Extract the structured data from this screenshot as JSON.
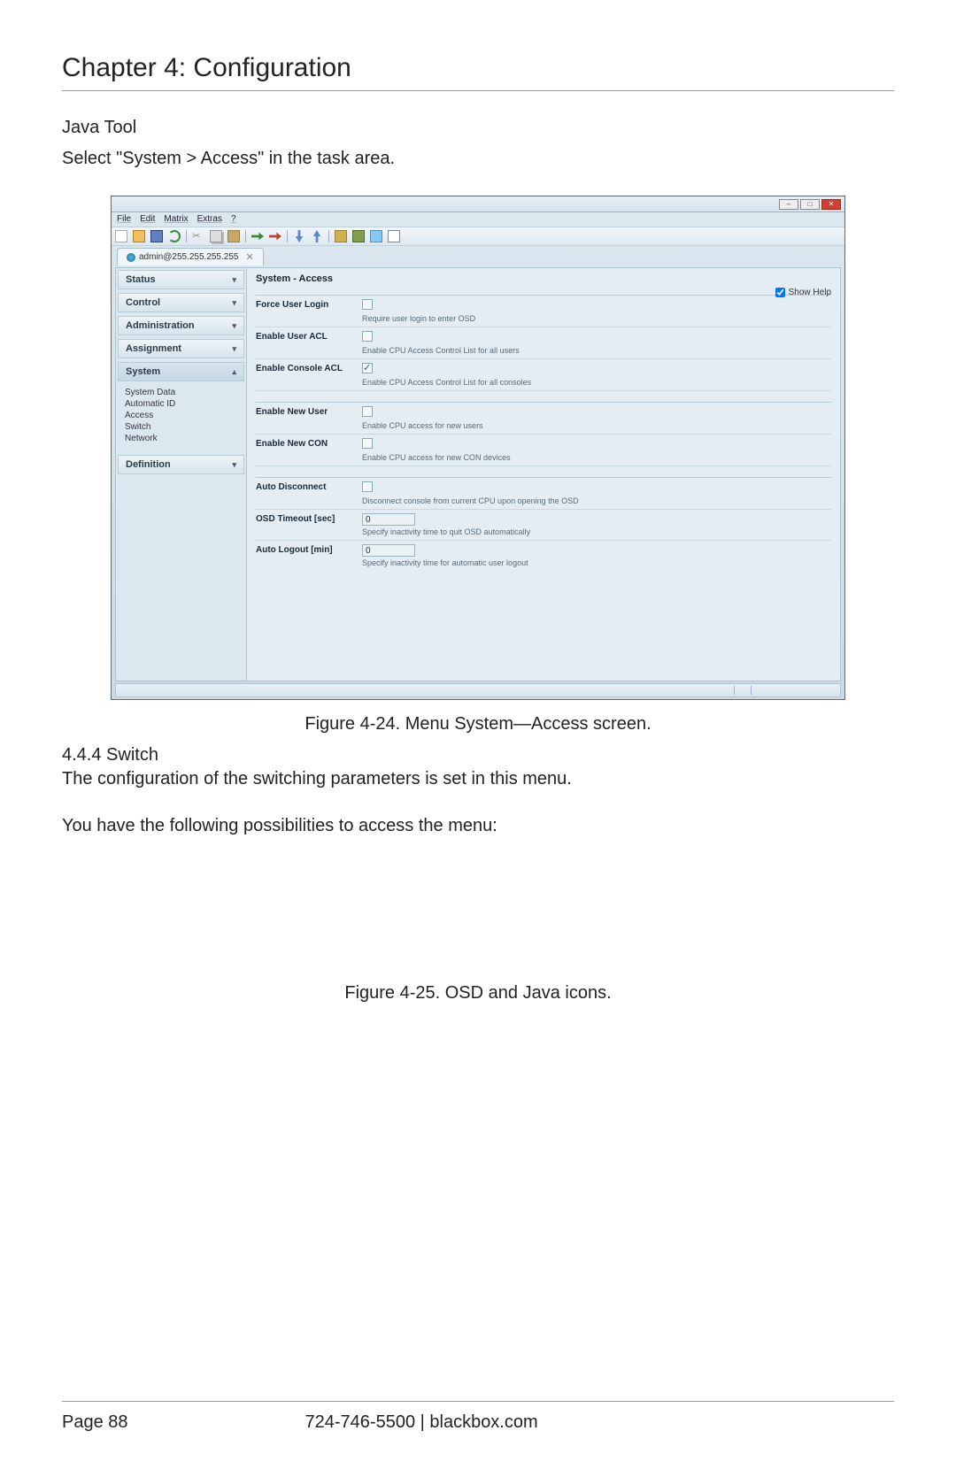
{
  "chapter_title": "Chapter 4: Configuration",
  "section_title": "Java Tool",
  "intro_text": "Select \"System > Access\" in the task area.",
  "figure24_caption": "Figure 4-24. Menu System—Access screen.",
  "subsection": "4.4.4 Switch",
  "switch_text1": "The configuration of the switching parameters is set in this menu.",
  "switch_text2": "You have the following possibilities to access the menu:",
  "figure25_caption": "Figure 4-25. OSD and Java icons.",
  "footer_page": "Page 88",
  "footer_contact": "724-746-5500   |   blackbox.com",
  "app": {
    "menubar": {
      "file": "File",
      "edit": "Edit",
      "matrix": "Matrix",
      "extras": "Extras",
      "help": "?"
    },
    "tab_label": "admin@255.255.255.255",
    "sidebar": {
      "items": [
        {
          "label": "Status",
          "arrow": "▾"
        },
        {
          "label": "Control",
          "arrow": "▾"
        },
        {
          "label": "Administration",
          "arrow": "▾"
        },
        {
          "label": "Assignment",
          "arrow": "▾"
        },
        {
          "label": "System",
          "arrow": "▴",
          "active": true
        },
        {
          "label": "Definition",
          "arrow": "▾"
        }
      ],
      "system_sub": [
        "System Data",
        "Automatic ID",
        "Access",
        "Switch",
        "Network"
      ]
    },
    "panel": {
      "title": "System - Access",
      "show_help": "Show Help",
      "show_help_checked": true,
      "rows": [
        {
          "label": "Force User Login",
          "type": "checkbox",
          "checked": false,
          "help": "Require user login to enter OSD"
        },
        {
          "label": "Enable User ACL",
          "type": "checkbox",
          "checked": false,
          "help": "Enable CPU Access Control List for all users"
        },
        {
          "label": "Enable Console ACL",
          "type": "checkbox",
          "checked": true,
          "help": "Enable CPU Access Control List for all consoles"
        }
      ],
      "rows2": [
        {
          "label": "Enable New User",
          "type": "checkbox",
          "checked": false,
          "help": "Enable CPU access for new users"
        },
        {
          "label": "Enable New CON",
          "type": "checkbox",
          "checked": false,
          "help": "Enable CPU access for new CON devices"
        }
      ],
      "rows3": [
        {
          "label": "Auto Disconnect",
          "type": "checkbox",
          "checked": false,
          "help": "Disconnect console from current CPU upon opening the OSD"
        },
        {
          "label": "OSD Timeout [sec]",
          "type": "number",
          "value": "0",
          "help": "Specify inactivity time to quit OSD automatically"
        },
        {
          "label": "Auto Logout [min]",
          "type": "number",
          "value": "0",
          "help": "Specify inactivity time for automatic user logout"
        }
      ]
    }
  }
}
